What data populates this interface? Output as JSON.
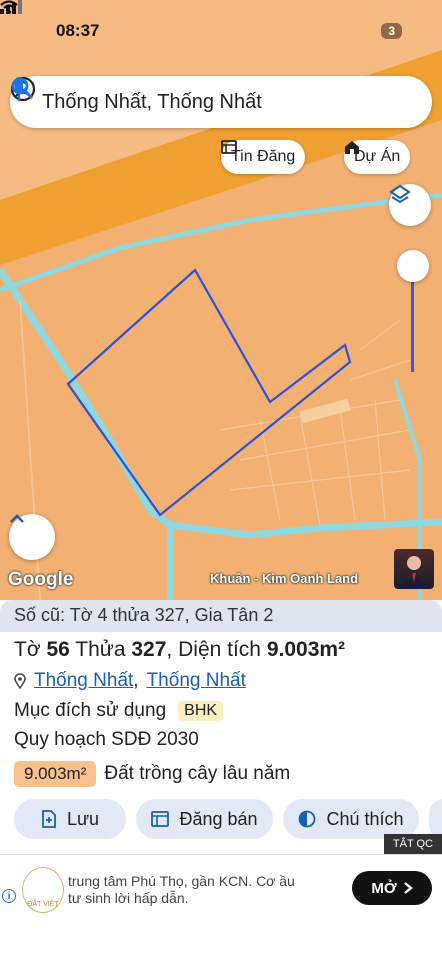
{
  "status_bar": {
    "time": "08:37",
    "battery": "3"
  },
  "search": {
    "query": "Thống Nhất, Thống Nhất"
  },
  "chips": {
    "listings": "Tin Đăng",
    "projects": "Dự Án"
  },
  "map": {
    "provider": "Google",
    "credit": "Khuân - Kim Oanh Land"
  },
  "parcel": {
    "old_info": "Số cũ: Tờ 4 thửa 327, Gia Tân 2",
    "sheet_label": "Tờ",
    "sheet_no": "56",
    "plot_label": "Thửa",
    "plot_no": "327",
    "area_label": "Diện tích",
    "area_value": "9.003m²",
    "commune": "Thống Nhất",
    "separator": ",",
    "district": "Thống Nhất",
    "purpose_label": "Mục đích sử dụng",
    "purpose_code": "BHK",
    "plan_label": "Quy hoạch SDĐ 2030",
    "plan_area": "9.003m²",
    "plan_type": "Đất trồng cây lâu năm"
  },
  "actions": {
    "save": "Lưu",
    "post_sale": "Đăng bán",
    "legend": "Chú thích"
  },
  "ad": {
    "close_label": "TẮT QC",
    "text": "trung tâm Phú Thọ, gần KCN. Cơ ầu tư sinh lời hấp dẫn.",
    "cta": "MỞ",
    "logo_text": "ĐẤT VIỆT"
  },
  "colors": {
    "map_bg": "#f2b072",
    "road": "#f0a030",
    "water": "#8fd8e0",
    "parcel_outline": "#3050d8",
    "accent": "#1a5fb4"
  }
}
